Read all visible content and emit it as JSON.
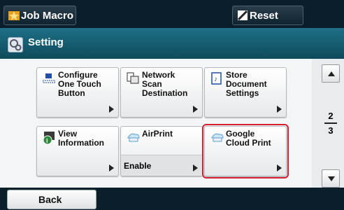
{
  "topbar": {
    "job_macro_label": "Job Macro",
    "reset_label": "Reset"
  },
  "header": {
    "title": "Setting"
  },
  "tiles": [
    {
      "label": "Configure\nOne Touch\nButton",
      "icon": "one-touch-icon"
    },
    {
      "label": "Network\nScan\nDestination",
      "icon": "network-scan-icon"
    },
    {
      "label": "Store\nDocument\nSettings",
      "icon": "store-document-icon"
    },
    {
      "label": "View\nInformation",
      "icon": "info-icon"
    },
    {
      "label": "AirPrint",
      "icon": "airprint-icon",
      "sub": "Enable"
    },
    {
      "label": "Google\nCloud Print",
      "icon": "cloud-print-icon",
      "selected": true
    }
  ],
  "pager": {
    "current": "2",
    "total": "3"
  },
  "bottombar": {
    "back_label": "Back"
  },
  "colors": {
    "selection_outline": "#d32030",
    "header_bg": "#1d6f86",
    "topbar_bg": "#0b1f2a"
  }
}
